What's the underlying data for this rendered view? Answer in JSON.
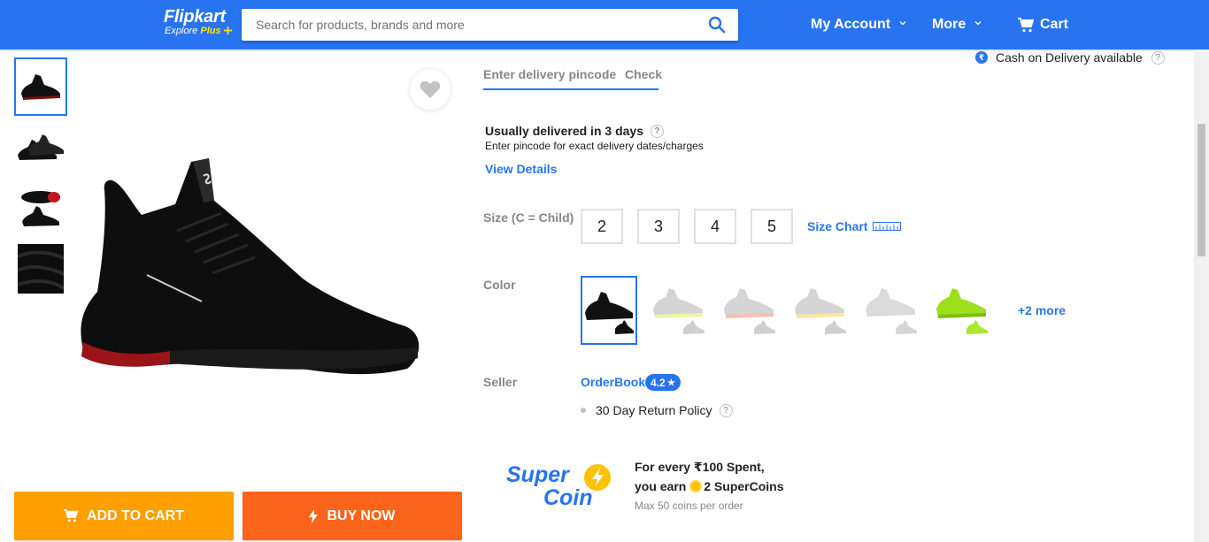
{
  "header": {
    "logo_text": "Flipkart",
    "logo_tagline_prefix": "Explore",
    "logo_tagline_plus": "Plus",
    "search_placeholder": "Search for products, brands and more",
    "my_account": "My Account",
    "more": "More",
    "cart": "Cart",
    "brand_color": "#2874f0"
  },
  "product": {
    "thumbnails": [
      "shoe-side-thumb",
      "shoe-pair-thumb",
      "shoe-sole-thumb",
      "fabric-closeup-thumb"
    ],
    "selected_thumbnail": 0
  },
  "actions": {
    "add_to_cart": "ADD TO CART",
    "buy_now": "BUY NOW",
    "add_to_cart_color": "#ff9f00",
    "buy_now_color": "#fb641b"
  },
  "delivery": {
    "pincode_placeholder": "Enter delivery pincode",
    "check": "Check",
    "cod": "Cash on Delivery available",
    "usually_prefix": "Usually delivered in",
    "usually_days": "3 days",
    "pincode_note": "Enter pincode for exact delivery dates/charges",
    "view_details": "View Details"
  },
  "size": {
    "label": "Size (C = Child)",
    "options": [
      "2",
      "3",
      "4",
      "5"
    ],
    "size_chart": "Size Chart"
  },
  "color": {
    "label": "Color",
    "more": "+2 more",
    "options": [
      "black",
      "grey-yellow",
      "grey-red",
      "grey-orange",
      "grey",
      "neon-green"
    ]
  },
  "seller": {
    "label": "Seller",
    "name": "OrderBook",
    "rating": "4.2",
    "return_policy": "30 Day Return Policy"
  },
  "supercoin": {
    "logo_line1": "Super",
    "logo_line2": "Coin",
    "line1": "For every ₹100 Spent,",
    "line2_prefix": "you earn",
    "line2_value": "2 SuperCoins",
    "line3": "Max 50 coins per order"
  }
}
